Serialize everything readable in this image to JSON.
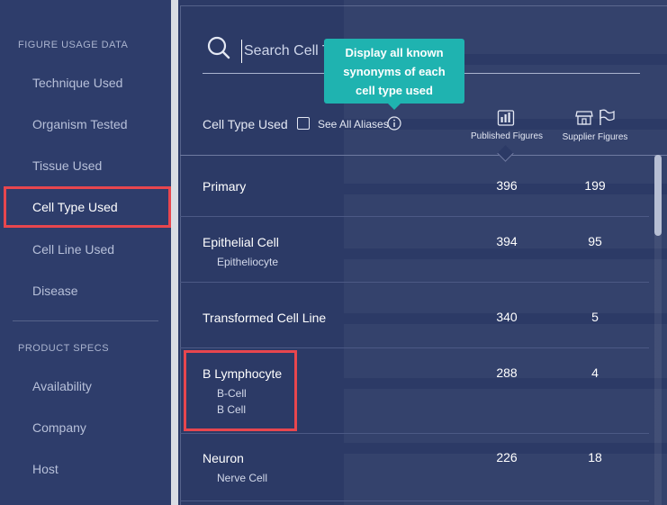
{
  "sidebar": {
    "figure_section": "FIGURE USAGE DATA",
    "figure_items": [
      {
        "label": "Technique Used"
      },
      {
        "label": "Organism Tested"
      },
      {
        "label": "Tissue Used"
      },
      {
        "label": "Cell Type Used"
      },
      {
        "label": "Cell Line Used"
      },
      {
        "label": "Disease"
      }
    ],
    "product_section": "PRODUCT SPECS",
    "product_items": [
      {
        "label": "Availability"
      },
      {
        "label": "Company"
      },
      {
        "label": "Host"
      }
    ]
  },
  "search": {
    "placeholder": "Search Cell Ty",
    "icon": "search-icon"
  },
  "tooltip": {
    "line1": "Display all known",
    "line2": "synonyms of each",
    "line3": "cell type used"
  },
  "header": {
    "column_title": "Cell Type Used",
    "aliases_label": "See All Aliases",
    "published_label": "Published Figures",
    "supplier_label": "Supplier Figures"
  },
  "rows": [
    {
      "name": "Primary",
      "aliases": [],
      "published": "396",
      "supplier": "199"
    },
    {
      "name": "Epithelial Cell",
      "aliases": [
        "Epitheliocyte"
      ],
      "published": "394",
      "supplier": "95"
    },
    {
      "name": "Transformed Cell Line",
      "aliases": [],
      "published": "340",
      "supplier": "5"
    },
    {
      "name": "B Lymphocyte",
      "aliases": [
        "B-Cell",
        "B Cell"
      ],
      "published": "288",
      "supplier": "4"
    },
    {
      "name": "Neuron",
      "aliases": [
        "Nerve Cell"
      ],
      "published": "226",
      "supplier": "18"
    }
  ],
  "colors": {
    "background": "#2c3a66",
    "accent": "#1fb3b0",
    "highlight": "#e8464e"
  }
}
